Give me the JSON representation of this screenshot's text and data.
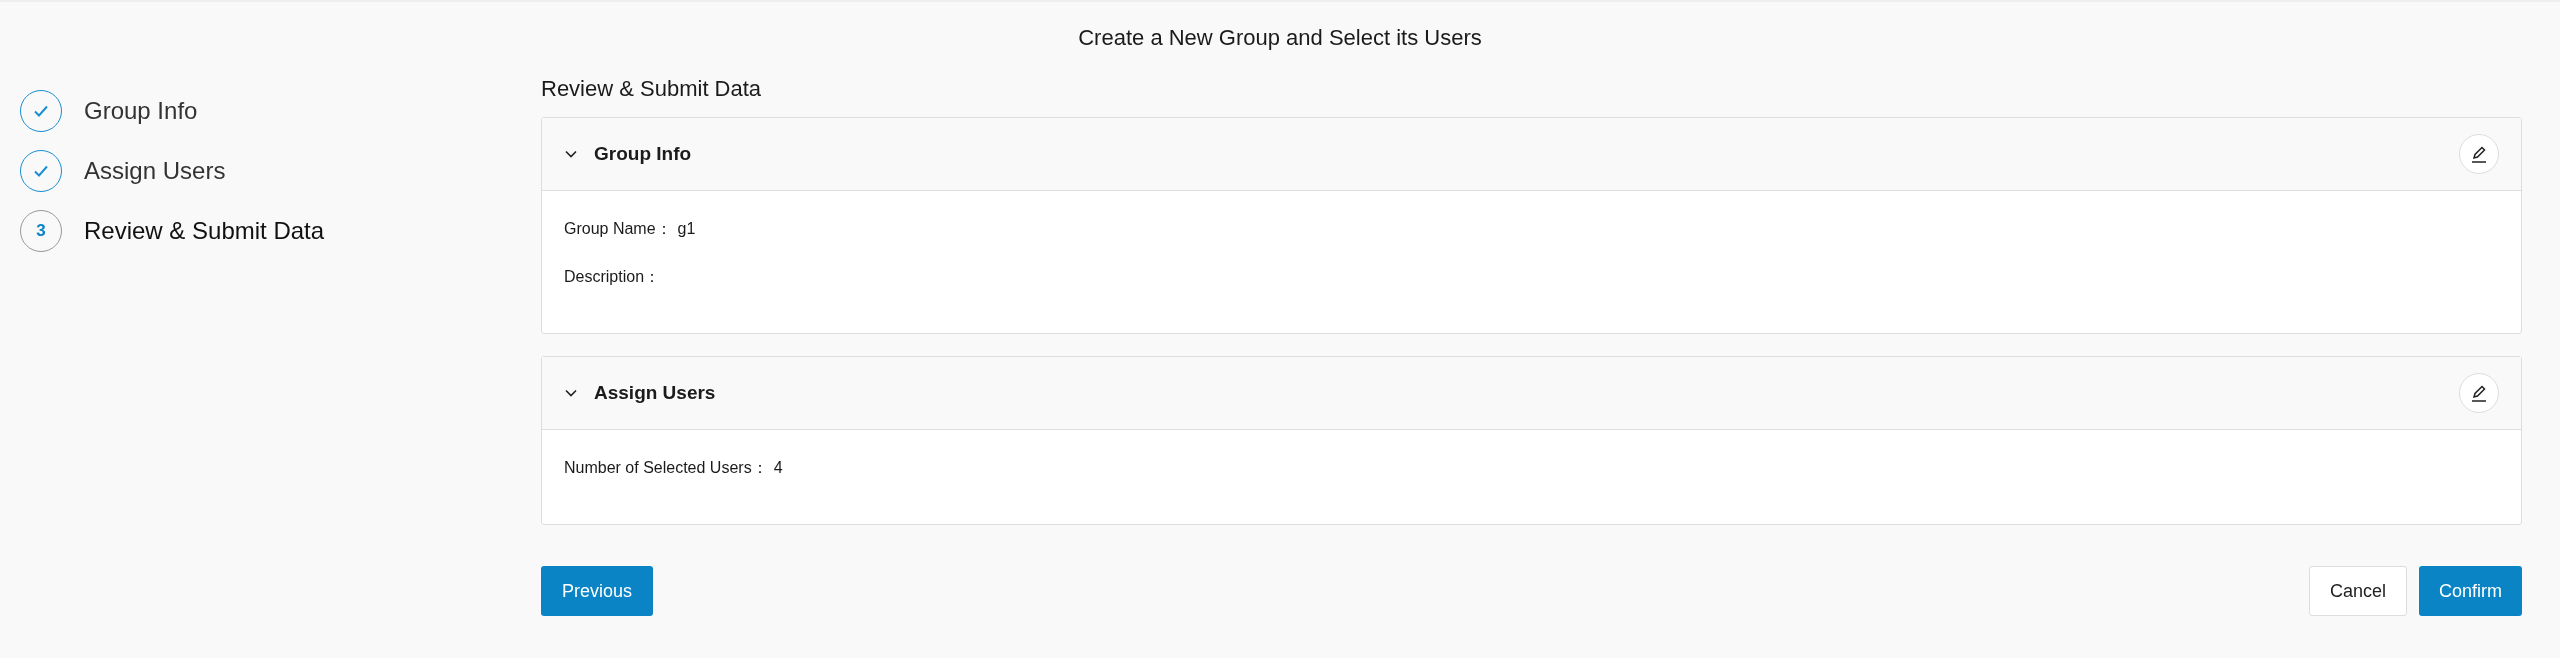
{
  "title": "Create a New Group and Select its Users",
  "steps": [
    {
      "label": "Group Info",
      "kind": "done",
      "selected": false
    },
    {
      "label": "Assign Users",
      "kind": "done",
      "selected": false
    },
    {
      "label": "Review & Submit Data",
      "kind": "current",
      "number": "3",
      "selected": true
    }
  ],
  "heading": "Review & Submit Data",
  "sections": [
    {
      "title": "Group Info",
      "expanded": true,
      "fields": [
        {
          "label": "Group Name：",
          "value": "g1"
        },
        {
          "label": "Description："
        }
      ]
    },
    {
      "title": "Assign Users",
      "expanded": true,
      "fields": [
        {
          "label": "Number of Selected Users：",
          "value": "4"
        }
      ]
    }
  ],
  "buttons": {
    "previous": "Previous",
    "cancel": "Cancel",
    "confirm": "Confirm"
  }
}
